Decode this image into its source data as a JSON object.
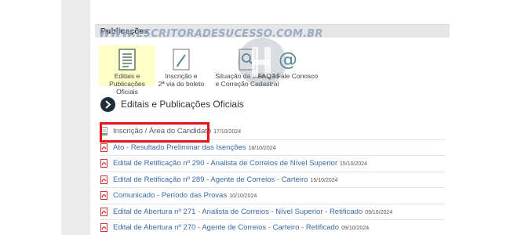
{
  "section": {
    "title": "Publicações"
  },
  "watermark": {
    "text": "WWW.ESCRITORADESUCESSO.COM.BR"
  },
  "tiles": [
    {
      "label_line1": "Editais e Publicações",
      "label_line2": "Oficiais",
      "icon": "document-list-icon"
    },
    {
      "label_line1": "Inscrição e",
      "label_line2": "2ª via do boleto",
      "icon": "pen-document-icon"
    },
    {
      "label_line1": "Situação da Inscrição",
      "label_line2": "e Correção Cadastral",
      "icon": "magnifier-document-icon"
    },
    {
      "label_line1": "FAQ / Fale Conosco",
      "label_line2": "",
      "icon": "at-sign-icon"
    }
  ],
  "subheader": {
    "title": "Editais e Publicações Oficiais"
  },
  "documents": [
    {
      "title": "Inscrição / Área do Candidato",
      "date": "17/10/2024"
    },
    {
      "title": "Ato - Resultado Preliminar das Isenções",
      "date": "18/10/2024"
    },
    {
      "title": "Edital de Retificação nº 290 - Analista de Correios de Nível Superior",
      "date": "15/10/2024"
    },
    {
      "title": "Edital de Retificação nº 289 - Agente de Correios - Carteiro",
      "date": "15/10/2024"
    },
    {
      "title": "Comunicado - Período das Provas",
      "date": "10/10/2024"
    },
    {
      "title": "Edital de Abertura nº 271 - Analista de Correios - Nível Superior - Retificado",
      "date": "09/10/2024"
    },
    {
      "title": "Edital de Abertura nº 270 - Agente de Correios - Carteiro - Retificado",
      "date": "09/10/2024"
    }
  ],
  "colors": {
    "link": "#3a6aa8",
    "highlight_border": "#e8141c",
    "active_tile": "#ffffc8"
  }
}
